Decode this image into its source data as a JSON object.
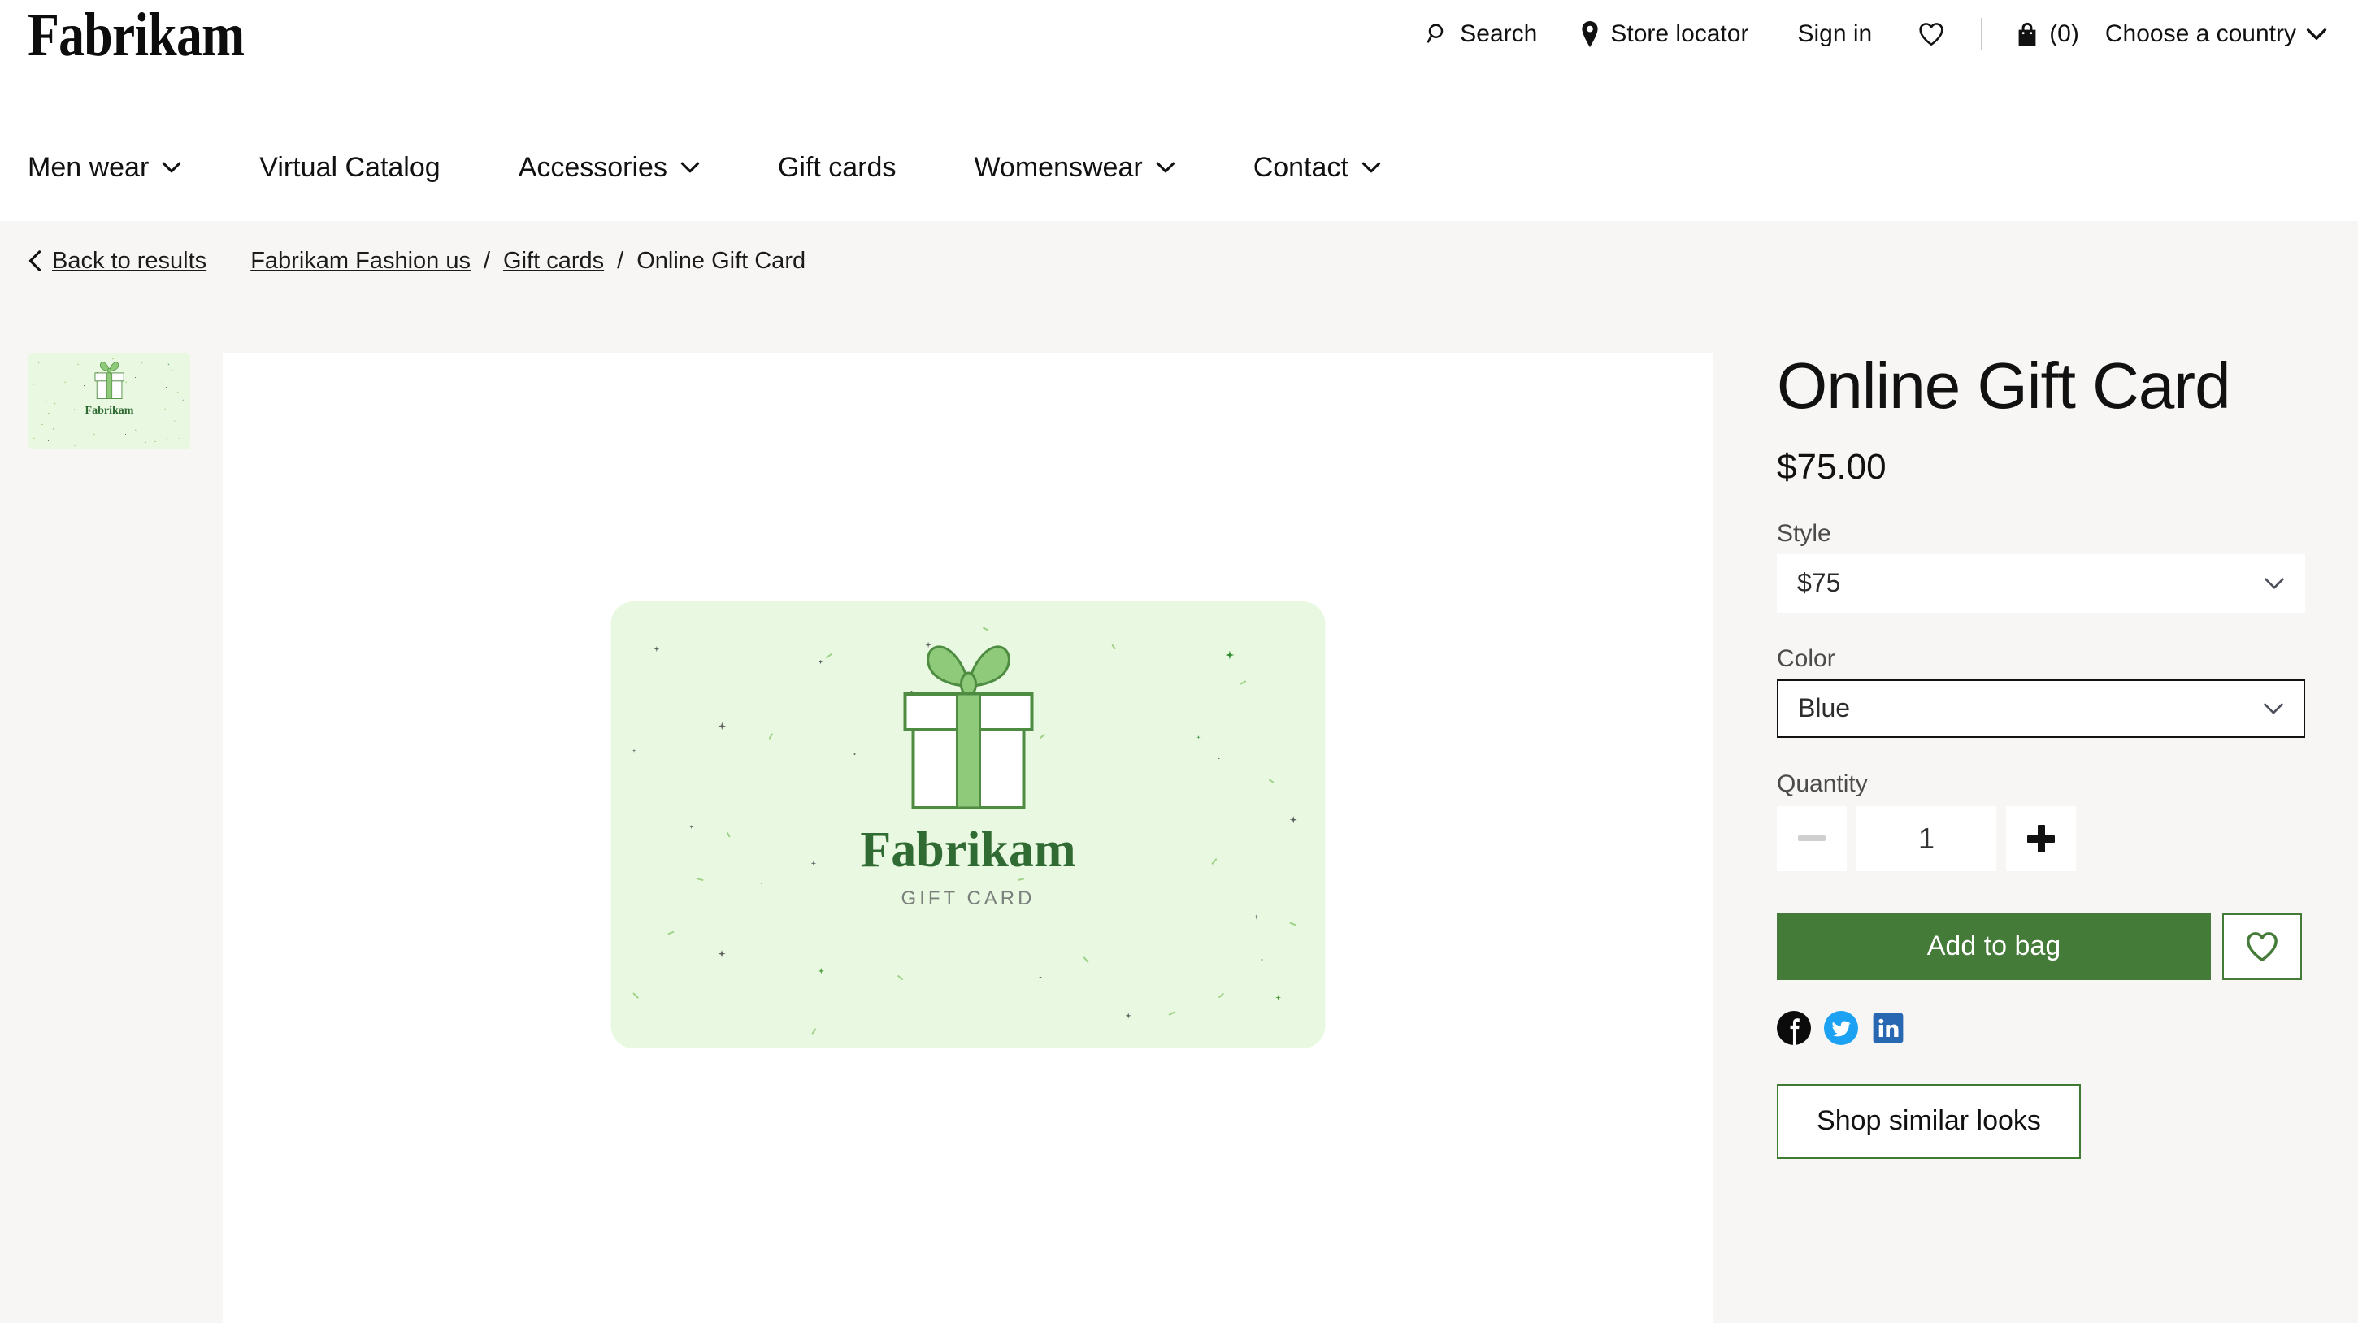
{
  "brand": {
    "logo_text": "Fabrikam"
  },
  "utility": {
    "search": {
      "label": "Search",
      "icon": "search-icon"
    },
    "store_locator": {
      "label": "Store locator",
      "icon": "location-pin-icon"
    },
    "sign_in": {
      "label": "Sign in"
    },
    "wishlist": {
      "icon": "heart-icon"
    },
    "bag": {
      "icon": "shopping-bag-icon",
      "count_label": "(0)"
    },
    "country": {
      "label": "Choose a country",
      "icon": "chevron-down-icon"
    }
  },
  "mainnav": {
    "items": [
      {
        "label": "Men wear",
        "has_caret": true
      },
      {
        "label": "Virtual Catalog",
        "has_caret": false
      },
      {
        "label": "Accessories",
        "has_caret": true
      },
      {
        "label": "Gift cards",
        "has_caret": false
      },
      {
        "label": "Womenswear",
        "has_caret": true
      },
      {
        "label": "Contact",
        "has_caret": true
      }
    ]
  },
  "breadcrumb": {
    "back_label": "Back to results",
    "back_icon": "chevron-left-icon",
    "items": [
      {
        "label": "Fabrikam Fashion us",
        "link": true
      },
      {
        "label": "Gift cards",
        "link": true
      },
      {
        "label": "Online Gift Card",
        "link": false
      }
    ],
    "separator": "/"
  },
  "gallery": {
    "thumbnail_alt": "Online Gift Card thumbnail",
    "card": {
      "brand_text": "Fabrikam",
      "sub_text": "GIFT CARD",
      "bg_color": "#e9f8e1",
      "ribbon_color": "#8fc97a",
      "outline_color": "#4e8c41",
      "brand_color": "#2f6b33",
      "sub_color": "#7a7f7c"
    }
  },
  "product": {
    "title": "Online Gift Card",
    "price": "$75.00",
    "style": {
      "label": "Style",
      "value": "$75",
      "caret": "chevron-down-icon"
    },
    "color": {
      "label": "Color",
      "value": "Blue",
      "caret": "chevron-down-icon",
      "focused": true
    },
    "quantity": {
      "label": "Quantity",
      "value": "1",
      "decrease_icon": "minus-icon",
      "increase_icon": "plus-icon",
      "decrease_disabled": true
    },
    "add_to_bag_label": "Add to bag",
    "wishlist_icon": "heart-icon",
    "shop_similar_label": "Shop similar looks",
    "social": [
      {
        "name": "facebook-icon",
        "color": "#0b0b0b"
      },
      {
        "name": "twitter-icon",
        "color": "#1da1f2"
      },
      {
        "name": "linkedin-icon",
        "color": "#2867b2"
      }
    ]
  },
  "theme": {
    "page_bg": "#f7f6f4",
    "panel_bg": "#ffffff",
    "accent_green": "#457b38",
    "text": "#111111"
  }
}
